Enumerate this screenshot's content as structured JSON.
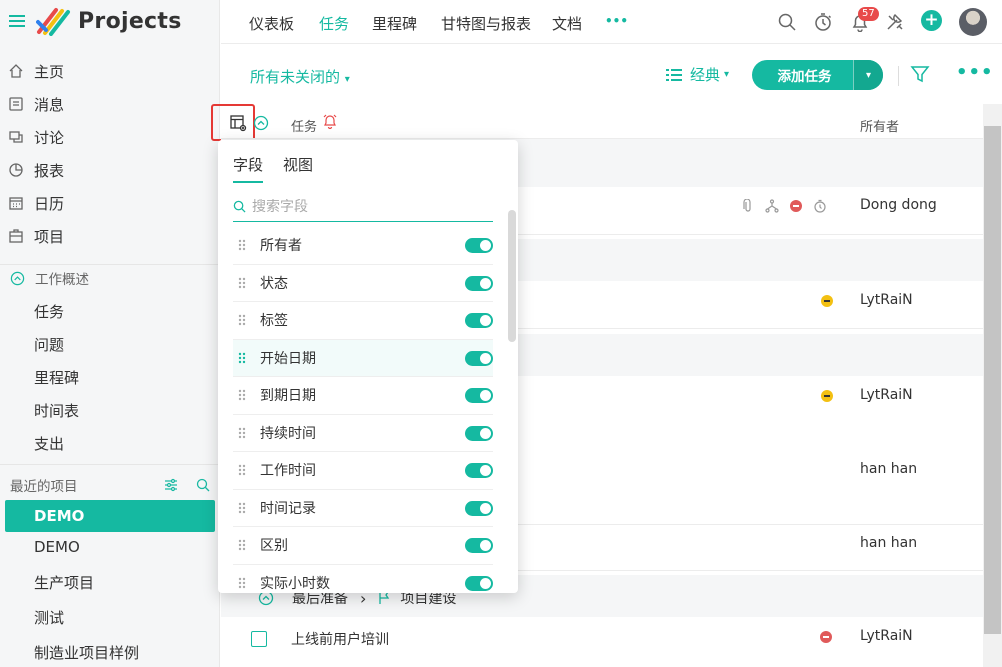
{
  "app": {
    "title": "Projects"
  },
  "sidebar": {
    "nav": [
      {
        "label": "主页",
        "icon": "home-icon"
      },
      {
        "label": "消息",
        "icon": "message-icon"
      },
      {
        "label": "讨论",
        "icon": "discussion-icon"
      },
      {
        "label": "报表",
        "icon": "report-icon"
      },
      {
        "label": "日历",
        "icon": "calendar-icon"
      },
      {
        "label": "项目",
        "icon": "project-icon"
      }
    ],
    "work_overview": {
      "label": "工作概述",
      "items": [
        "任务",
        "问题",
        "里程碑",
        "时间表",
        "支出"
      ]
    },
    "recent": {
      "label": "最近的项目",
      "projects": [
        "DEMO",
        "DEMO",
        "生产项目",
        "测试",
        "制造业项目样例"
      ]
    }
  },
  "topnav": {
    "tabs": [
      "仪表板",
      "任务",
      "里程碑",
      "甘特图与报表",
      "文档"
    ],
    "more": "•••",
    "active": "任务",
    "notification_count": "57",
    "add": "+"
  },
  "toolbar": {
    "filter": "所有未关闭的",
    "view": "经典",
    "add_task": "添加任务",
    "more": "•••"
  },
  "table": {
    "header": {
      "task": "任务",
      "owner": "所有者"
    },
    "owners": [
      "Dong dong",
      "LytRaiN",
      "LytRaiN",
      "han han",
      "han han",
      "LytRaiN"
    ],
    "group": {
      "name": "最后准备",
      "breadcrumb_sep": "›",
      "project": "项目建设"
    },
    "task": {
      "name": "上线前用户培训"
    }
  },
  "popover": {
    "tabs": [
      "字段",
      "视图"
    ],
    "search_placeholder": "搜索字段",
    "fields": [
      "所有者",
      "状态",
      "标签",
      "开始日期",
      "到期日期",
      "持续时间",
      "工作时间",
      "时间记录",
      "区别",
      "实际小时数"
    ]
  },
  "colors": {
    "accent": "#15b9a1",
    "danger": "#e84a4a",
    "warning": "#f3c012"
  }
}
